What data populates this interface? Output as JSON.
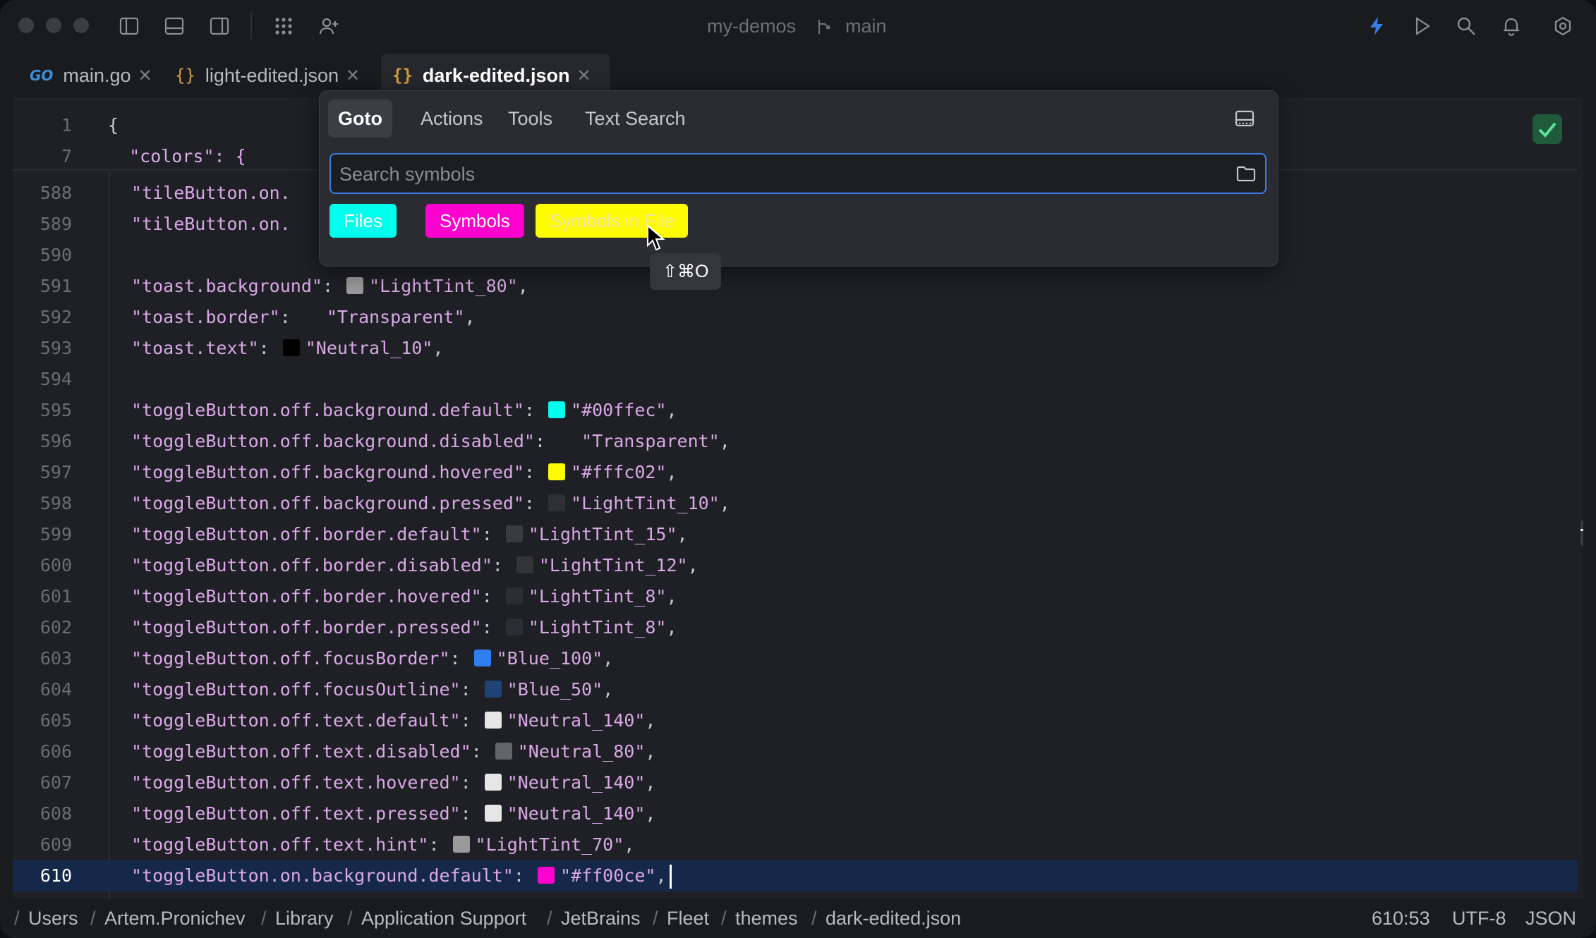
{
  "window": {
    "project": "my-demos",
    "branch": "main"
  },
  "tabs": [
    {
      "label": "main.go",
      "icon": "GO"
    },
    {
      "label": "light-edited.json",
      "icon": "{}"
    },
    {
      "label": "dark-edited.json",
      "icon": "{}"
    }
  ],
  "editor": {
    "sticky": [
      {
        "num": "1",
        "text": "{"
      },
      {
        "num": "7",
        "text": "  \"colors\": {"
      }
    ],
    "lines": [
      {
        "num": "588",
        "key": "\"tileButton.on.",
        "swatch": null,
        "value": "",
        "tail": ""
      },
      {
        "num": "589",
        "key": "\"tileButton.on.",
        "swatch": null,
        "value": "",
        "tail": ""
      },
      {
        "num": "590",
        "key": "",
        "swatch": null,
        "value": "",
        "tail": ""
      },
      {
        "num": "591",
        "key": "\"toast.background\"",
        "swatch": "#9a9a9a",
        "value": "\"LightTint_80\"",
        "tail": ","
      },
      {
        "num": "592",
        "key": "\"toast.border\"",
        "swatch": "transparent",
        "value": "\"Transparent\"",
        "tail": ","
      },
      {
        "num": "593",
        "key": "\"toast.text\"",
        "swatch": "#000000",
        "value": "\"Neutral_10\"",
        "tail": ","
      },
      {
        "num": "594",
        "key": "",
        "swatch": null,
        "value": "",
        "tail": ""
      },
      {
        "num": "595",
        "key": "\"toggleButton.off.background.default\"",
        "swatch": "#00ffec",
        "value": "\"#00ffec\"",
        "tail": ","
      },
      {
        "num": "596",
        "key": "\"toggleButton.off.background.disabled\"",
        "swatch": "transparent",
        "value": "\"Transparent\"",
        "tail": ","
      },
      {
        "num": "597",
        "key": "\"toggleButton.off.background.hovered\"",
        "swatch": "#fffc02",
        "value": "\"#fffc02\"",
        "tail": ","
      },
      {
        "num": "598",
        "key": "\"toggleButton.off.background.pressed\"",
        "swatch": "#2e3034",
        "value": "\"LightTint_10\"",
        "tail": ","
      },
      {
        "num": "599",
        "key": "\"toggleButton.off.border.default\"",
        "swatch": "#393b40",
        "value": "\"LightTint_15\"",
        "tail": ","
      },
      {
        "num": "600",
        "key": "\"toggleButton.off.border.disabled\"",
        "swatch": "#33353a",
        "value": "\"LightTint_12\"",
        "tail": ","
      },
      {
        "num": "601",
        "key": "\"toggleButton.off.border.hovered\"",
        "swatch": "#2b2d32",
        "value": "\"LightTint_8\"",
        "tail": ","
      },
      {
        "num": "602",
        "key": "\"toggleButton.off.border.pressed\"",
        "swatch": "#2b2d32",
        "value": "\"LightTint_8\"",
        "tail": ","
      },
      {
        "num": "603",
        "key": "\"toggleButton.off.focusBorder\"",
        "swatch": "#2f7ef0",
        "value": "\"Blue_100\"",
        "tail": ","
      },
      {
        "num": "604",
        "key": "\"toggleButton.off.focusOutline\"",
        "swatch": "#1f4376",
        "value": "\"Blue_50\"",
        "tail": ","
      },
      {
        "num": "605",
        "key": "\"toggleButton.off.text.default\"",
        "swatch": "#e6e6e6",
        "value": "\"Neutral_140\"",
        "tail": ","
      },
      {
        "num": "606",
        "key": "\"toggleButton.off.text.disabled\"",
        "swatch": "#62656b",
        "value": "\"Neutral_80\"",
        "tail": ","
      },
      {
        "num": "607",
        "key": "\"toggleButton.off.text.hovered\"",
        "swatch": "#e6e6e6",
        "value": "\"Neutral_140\"",
        "tail": ","
      },
      {
        "num": "608",
        "key": "\"toggleButton.off.text.pressed\"",
        "swatch": "#e6e6e6",
        "value": "\"Neutral_140\"",
        "tail": ","
      },
      {
        "num": "609",
        "key": "\"toggleButton.off.text.hint\"",
        "swatch": "#9a9a9a",
        "value": "\"LightTint_70\"",
        "tail": ","
      },
      {
        "num": "610",
        "key": "\"toggleButton.on.background.default\"",
        "swatch": "#ff00ce",
        "value": "\"#ff00ce\"",
        "tail": ","
      }
    ],
    "current_line": "610"
  },
  "popup": {
    "tabs": [
      "Goto",
      "Actions",
      "Tools",
      "Text Search"
    ],
    "active_tab": "Goto",
    "search_placeholder": "Search symbols",
    "search_value": "",
    "chips": [
      {
        "label": "Files",
        "bg": "#00ffec",
        "fg": "#ffffff"
      },
      {
        "label": "Symbols",
        "bg": "#ff00ce",
        "fg": "#ffffff"
      },
      {
        "label": "Symbols in File",
        "bg": "#fffc02",
        "fg": "#f0e8a0"
      }
    ],
    "tooltip": "⇧⌘O"
  },
  "status": {
    "breadcrumb": [
      "Users",
      "Artem.Pronichev",
      "Library",
      "Application Support",
      "JetBrains",
      "Fleet",
      "themes",
      "dark-edited.json"
    ],
    "position": "610:53",
    "encoding": "UTF-8",
    "language": "JSON"
  },
  "colors": {
    "accent": "#3c7ee8",
    "lightning": "#3c7ee8"
  }
}
